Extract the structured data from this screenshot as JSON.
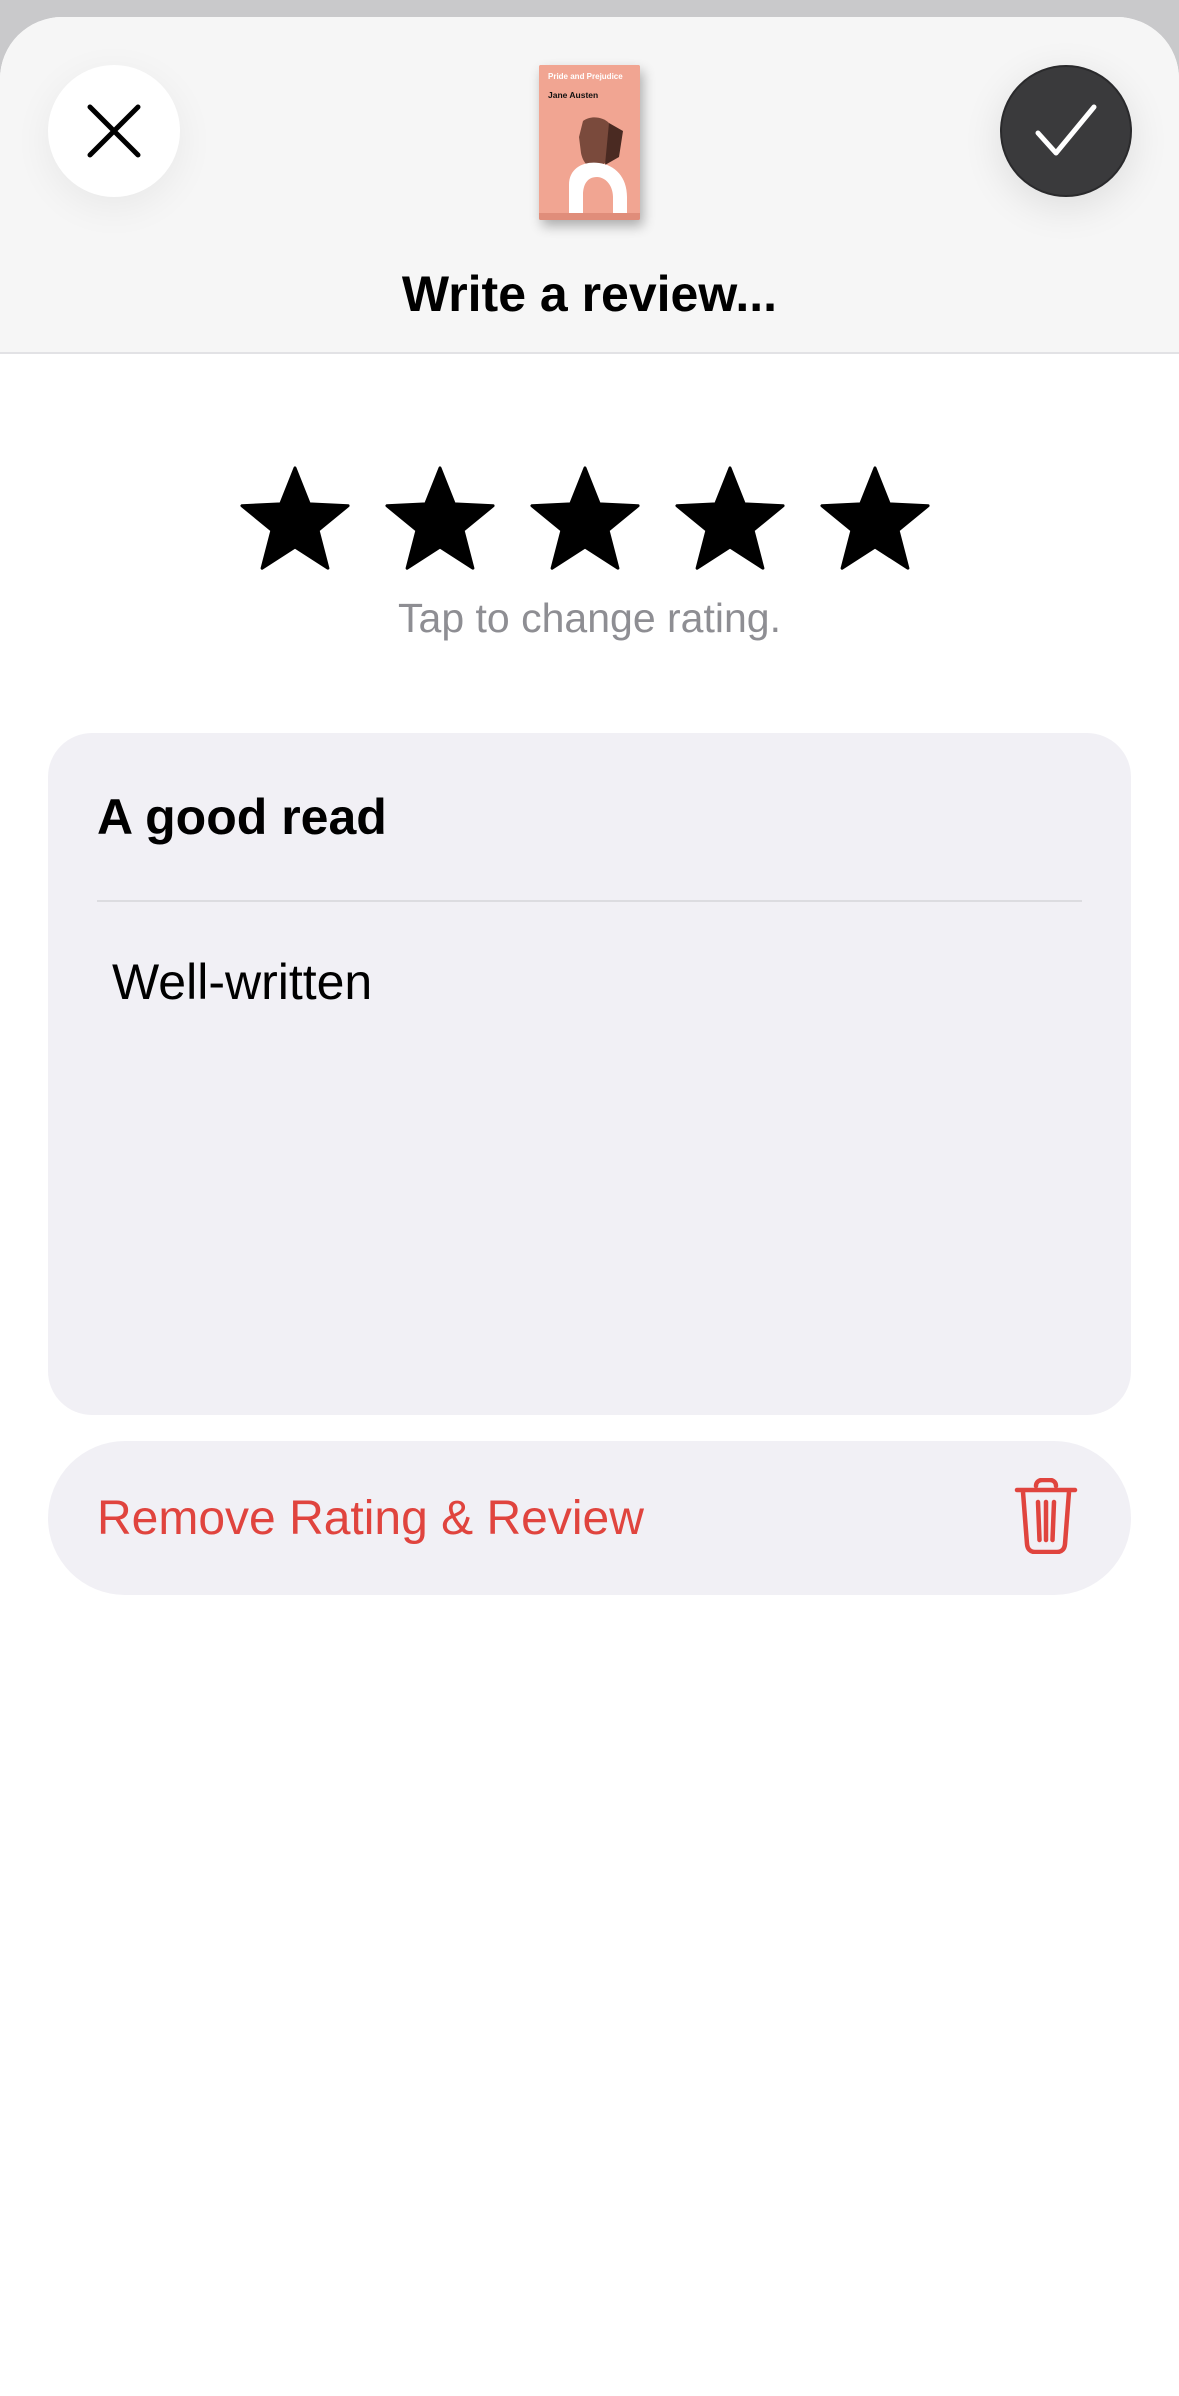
{
  "header": {
    "title": "Write a review...",
    "close_icon": "close-icon",
    "done_icon": "checkmark-icon"
  },
  "book": {
    "cover_title": "Pride and Prejudice",
    "cover_author": "Jane Austen",
    "cover_color": "#f1a592"
  },
  "rating": {
    "value": 5,
    "max": 5,
    "hint": "Tap to change rating."
  },
  "review": {
    "title": "A good read",
    "body": "Well-written"
  },
  "remove": {
    "label": "Remove Rating & Review",
    "icon": "trash-icon",
    "color": "#e0443e"
  }
}
